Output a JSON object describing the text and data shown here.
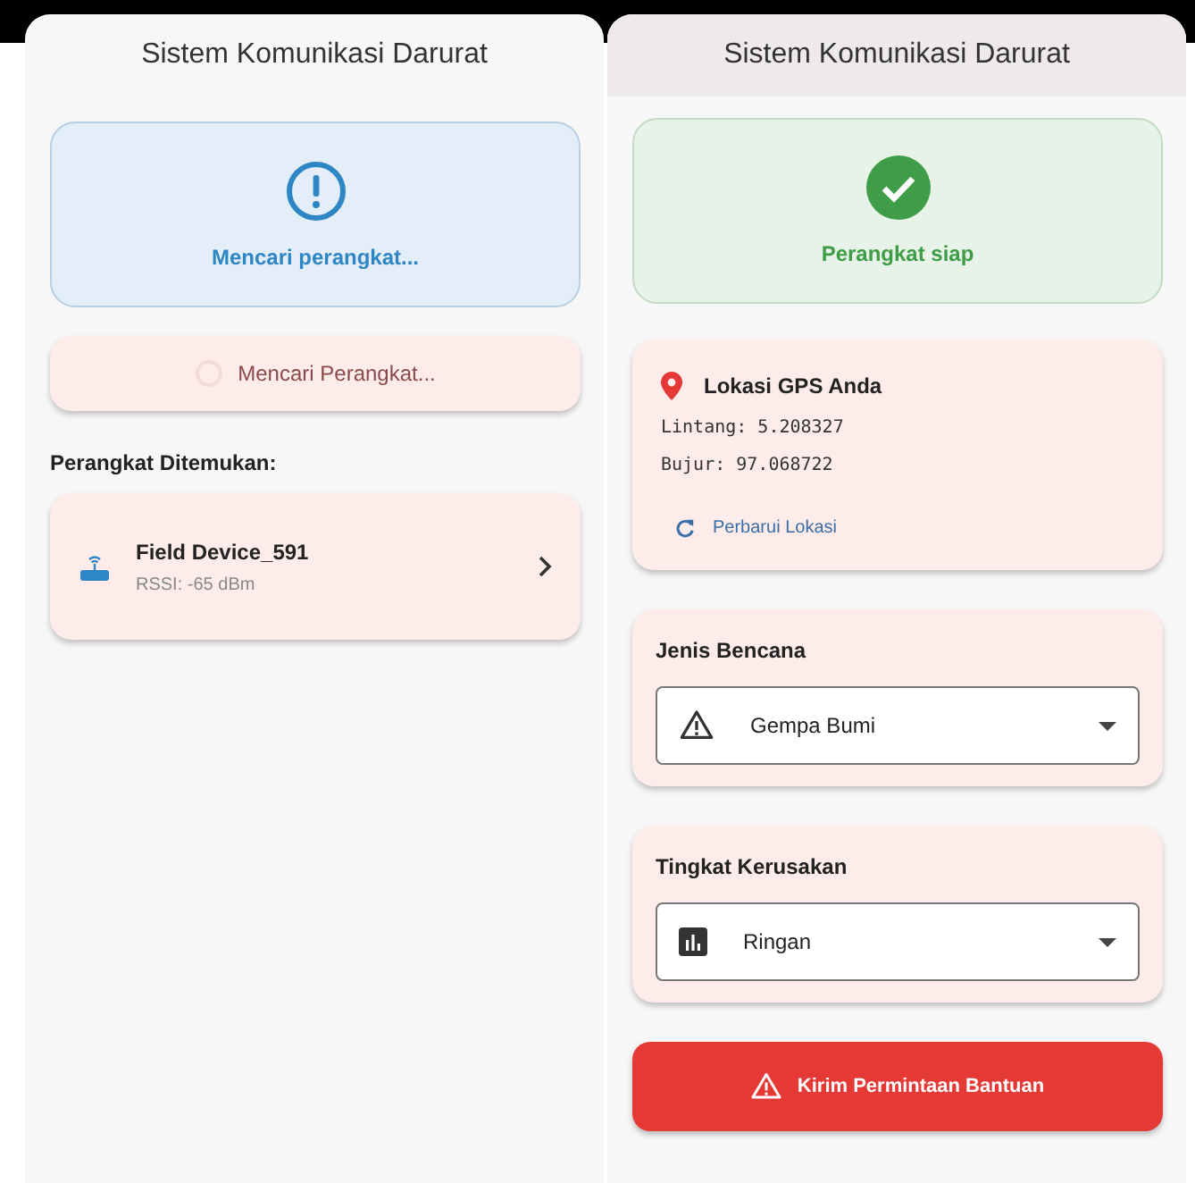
{
  "left_screen": {
    "title": "Sistem Komunikasi Darurat",
    "status": {
      "kind": "searching",
      "text": "Mencari perangkat..."
    },
    "scan_button": {
      "label": "Mencari Perangkat...",
      "loading": true
    },
    "section_label": "Perangkat Ditemukan:",
    "devices": [
      {
        "name": "Field Device_591",
        "rssi": "RSSI: -65 dBm"
      }
    ]
  },
  "right_screen": {
    "title": "Sistem Komunikasi Darurat",
    "status": {
      "kind": "ready",
      "text": "Perangkat siap"
    },
    "location": {
      "title": "Lokasi GPS Anda",
      "lines": [
        "Lintang: 5.208327",
        "Bujur: 97.068722"
      ],
      "refresh_label": "Perbarui Lokasi"
    },
    "selectors": [
      {
        "label": "Jenis Bencana",
        "value": "Gempa Bumi",
        "kind": "warning"
      },
      {
        "label": "Tingkat Kerusakan",
        "value": "Ringan",
        "kind": "chart"
      }
    ],
    "send_button": "Kirim Permintaan Bantuan"
  }
}
